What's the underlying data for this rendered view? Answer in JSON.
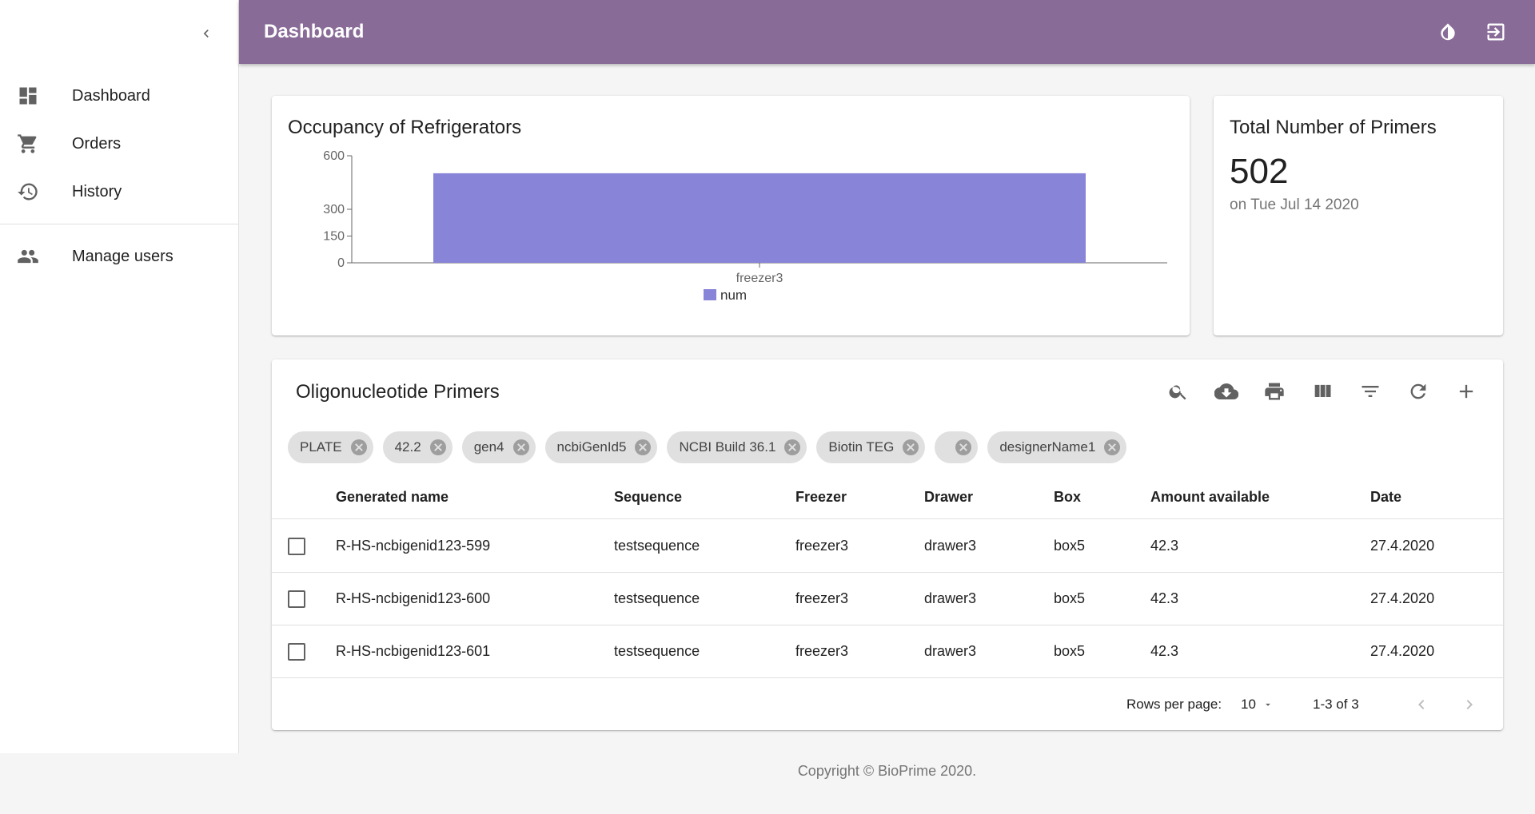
{
  "app": {
    "title": "Dashboard"
  },
  "colors": {
    "header": "#896b98",
    "bar": "#8884d8"
  },
  "sidebar": {
    "collapse_icon": "chevron-left-icon",
    "items": [
      {
        "label": "Dashboard",
        "icon": "dashboard-icon"
      },
      {
        "label": "Orders",
        "icon": "cart-icon"
      },
      {
        "label": "History",
        "icon": "history-icon"
      },
      {
        "label": "Manage users",
        "icon": "people-icon"
      }
    ]
  },
  "header_actions": [
    {
      "icon": "theme-toggle-icon"
    },
    {
      "icon": "logout-icon"
    }
  ],
  "chart_card": {
    "title": "Occupancy of Refrigerators"
  },
  "chart_data": {
    "type": "bar",
    "title": "Occupancy of Refrigerators",
    "categories": [
      "freezer3"
    ],
    "series": [
      {
        "name": "num",
        "values": [
          502
        ]
      }
    ],
    "yticks": [
      0,
      150,
      300,
      600
    ],
    "ylim": [
      0,
      600
    ],
    "legend": "bottom",
    "grid": false
  },
  "total_card": {
    "title": "Total Number of Primers",
    "value": "502",
    "subtitle": "on Tue Jul 14 2020"
  },
  "table": {
    "title": "Oligonucleotide Primers",
    "toolbar": [
      "search-icon",
      "cloud-download-icon",
      "print-icon",
      "view-columns-icon",
      "filter-icon",
      "refresh-icon",
      "add-icon"
    ],
    "chips": [
      "PLATE",
      "42.2",
      "gen4",
      "ncbiGenId5",
      "NCBI Build 36.1",
      "Biotin TEG",
      "",
      "designerName1"
    ],
    "columns": [
      "Generated name",
      "Sequence",
      "Freezer",
      "Drawer",
      "Box",
      "Amount available",
      "Date"
    ],
    "rows": [
      [
        "R-HS-ncbigenid123-599",
        "testsequence",
        "freezer3",
        "drawer3",
        "box5",
        "42.3",
        "27.4.2020"
      ],
      [
        "R-HS-ncbigenid123-600",
        "testsequence",
        "freezer3",
        "drawer3",
        "box5",
        "42.3",
        "27.4.2020"
      ],
      [
        "R-HS-ncbigenid123-601",
        "testsequence",
        "freezer3",
        "drawer3",
        "box5",
        "42.3",
        "27.4.2020"
      ]
    ],
    "pagination": {
      "rows_per_page_label": "Rows per page:",
      "rows_per_page": "10",
      "range": "1-3 of 3"
    }
  },
  "footer": {
    "text": "Copyright © BioPrime 2020."
  }
}
